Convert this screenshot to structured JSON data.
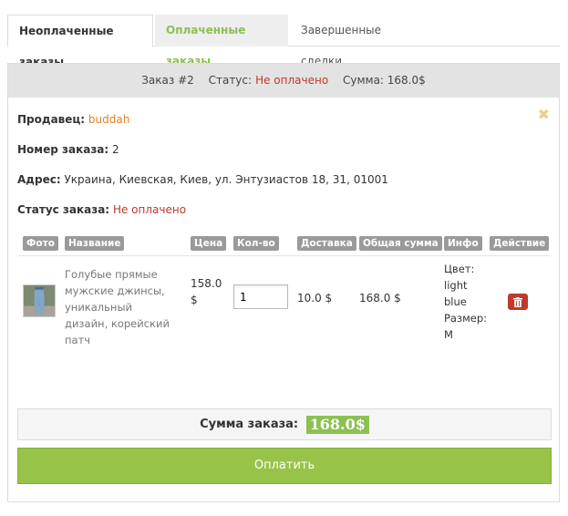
{
  "tabs": [
    {
      "label": "Неоплаченные заказы"
    },
    {
      "label": "Оплаченные заказы"
    },
    {
      "label": "Завершенные сделки"
    }
  ],
  "order_header": {
    "order": "Заказ #2",
    "status_label": "Статус:",
    "status_value": "Не оплачено",
    "sum": "Сумма: 168.0$"
  },
  "details": {
    "seller_label": "Продавец:",
    "seller_value": "buddah",
    "number_label": "Номер заказа:",
    "number_value": "2",
    "address_label": "Адрес:",
    "address_value": "Украина, Киевская, Киев, ул. Энтузиастов 18, 31, 01001",
    "status_label": "Статус заказа:",
    "status_value": "Не оплачено"
  },
  "table": {
    "headers": [
      "Фото",
      "Название",
      "Цена",
      "Кол-во",
      "Доставка",
      "Общая сумма",
      "Инфо",
      "Действие"
    ],
    "row": {
      "name": "Голубые прямые мужские джинсы, уникальный дизайн, корейский патч",
      "price": "158.0 $",
      "qty": "1",
      "delivery": "10.0 $",
      "total": "168.0 $",
      "info": "Цвет: light blue Размер: M"
    }
  },
  "summary": {
    "label": "Сумма заказа:",
    "value": "168.0$"
  },
  "pay_button": "Оплатить",
  "colors": {
    "accent_green": "#8cc152",
    "status_red": "#c0392b",
    "seller_orange": "#e67e22"
  }
}
